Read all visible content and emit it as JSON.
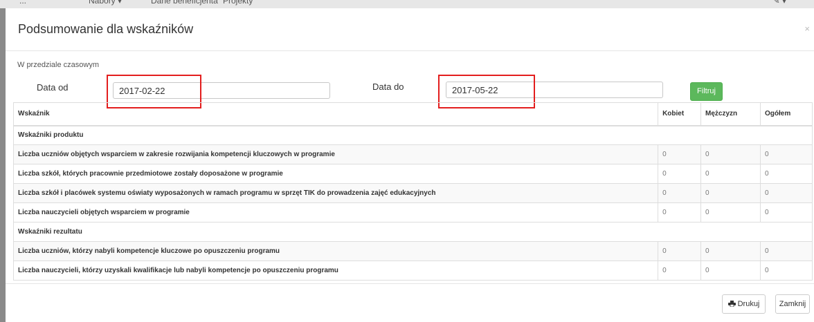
{
  "background_nav": {
    "items": [
      "...",
      "Nabory ▾",
      "Dane beneficjenta",
      "Projekty"
    ],
    "right": "✎ ▾"
  },
  "modal": {
    "title": "Podsumowanie dla wskaźników",
    "close_glyph": "×",
    "range_label": "W przedziale czasowym",
    "date_from_label": "Data od",
    "date_from_value": "2017-02-22",
    "date_to_label": "Data do",
    "date_to_value": "2017-05-22",
    "filter_button": "Filtruj"
  },
  "table": {
    "headers": [
      "Wskaźnik",
      "Kobiet",
      "Mężczyzn",
      "Ogółem"
    ],
    "sections": [
      {
        "title": "Wskaźniki produktu",
        "rows": [
          {
            "name": "Liczba uczniów objętych wsparciem w zakresie rozwijania kompetencji kluczowych w programie",
            "kobiet": "0",
            "mezczyzn": "0",
            "ogolem": "0"
          },
          {
            "name": "Liczba szkół, których pracownie przedmiotowe zostały doposażone w programie",
            "kobiet": "0",
            "mezczyzn": "0",
            "ogolem": "0"
          },
          {
            "name": "Liczba szkół i placówek systemu oświaty wyposażonych w ramach programu w sprzęt TIK do prowadzenia zajęć edukacyjnych",
            "kobiet": "0",
            "mezczyzn": "0",
            "ogolem": "0"
          },
          {
            "name": "Liczba nauczycieli objętych wsparciem w programie",
            "kobiet": "0",
            "mezczyzn": "0",
            "ogolem": "0"
          }
        ]
      },
      {
        "title": "Wskaźniki rezultatu",
        "rows": [
          {
            "name": "Liczba uczniów, którzy nabyli kompetencje kluczowe po opuszczeniu programu",
            "kobiet": "0",
            "mezczyzn": "0",
            "ogolem": "0"
          },
          {
            "name": "Liczba nauczycieli, którzy uzyskali kwalifikacje lub nabyli kompetencje po opuszczeniu programu",
            "kobiet": "0",
            "mezczyzn": "0",
            "ogolem": "0"
          }
        ]
      }
    ]
  },
  "footer": {
    "print_button": "Drukuj",
    "close_button": "Zamknij"
  },
  "colors": {
    "filter_button": "#5cb85c",
    "highlight_box": "#e31d1d"
  }
}
